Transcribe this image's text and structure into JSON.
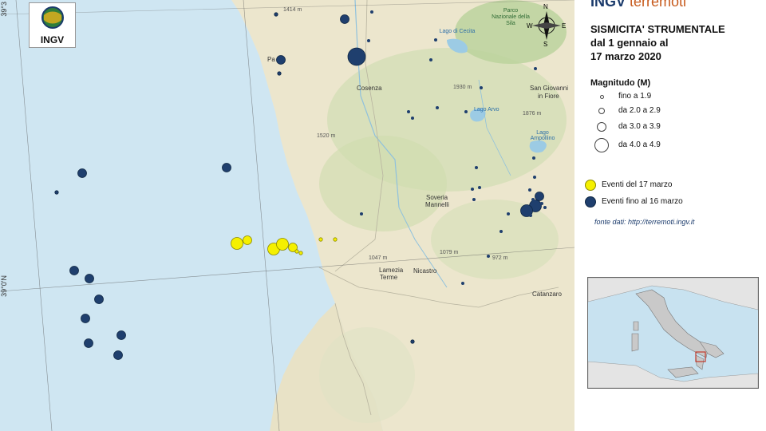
{
  "brand": {
    "part1": "INGV",
    "part2": "terremoti"
  },
  "logo": {
    "text": "INGV"
  },
  "title": {
    "line1": "SISMICITA' STRUMENTALE",
    "line2": "dal 1 gennaio al",
    "line3": "17 marzo 2020"
  },
  "magnitude_legend": {
    "title": "Magnitudo (M)",
    "classes": [
      {
        "label": "fino a 1.9",
        "size": 1
      },
      {
        "label": "da 2.0 a 2.9",
        "size": 2
      },
      {
        "label": "da 3.0 a 3.9",
        "size": 3
      },
      {
        "label": "da 4.0 a 4.9",
        "size": 4
      }
    ]
  },
  "event_legend": [
    {
      "label": "Eventi del 17 marzo",
      "color": "#f5f000"
    },
    {
      "label": "Eventi fino al 16 marzo",
      "color": "#1f3f6e"
    }
  ],
  "source": "fonte dati: http://terremoti.ingv.it",
  "lat_labels": {
    "top": "39°3",
    "middle": "39°0'N"
  },
  "compass": {
    "n": "N",
    "s": "S",
    "e": "E",
    "w": "W"
  },
  "colors": {
    "sea": "#cfe6f2",
    "land": "#ece6cd",
    "event_old": "#1f3f6e",
    "event_new": "#f5f000",
    "brand_red": "#c75a1c"
  },
  "places": [
    {
      "name": "Cosenza",
      "kind": "city"
    },
    {
      "name": "San Giovanni",
      "kind": "city"
    },
    {
      "name": "in Fiore",
      "kind": "city"
    },
    {
      "name": "Soveria",
      "kind": "city"
    },
    {
      "name": "Mannelli",
      "kind": "city"
    },
    {
      "name": "Lamezia",
      "kind": "city"
    },
    {
      "name": "Terme",
      "kind": "city"
    },
    {
      "name": "Nicastro",
      "kind": "city"
    },
    {
      "name": "Catanzaro",
      "kind": "city"
    },
    {
      "name": "Lago di Cecita",
      "kind": "lake"
    },
    {
      "name": "Lago Arvo",
      "kind": "lake"
    },
    {
      "name": "Lago Ampollino",
      "kind": "lake"
    },
    {
      "name": "Parco Nazionale della Sila",
      "kind": "park"
    },
    {
      "name": "1414 m",
      "kind": "elev"
    },
    {
      "name": "1930 m",
      "kind": "elev"
    },
    {
      "name": "1876 m",
      "kind": "elev"
    },
    {
      "name": "1520 m",
      "kind": "elev"
    },
    {
      "name": "1047 m",
      "kind": "elev"
    },
    {
      "name": "1079 m",
      "kind": "elev"
    },
    {
      "name": "972 m",
      "kind": "elev"
    },
    {
      "name": "Pa",
      "kind": "city"
    }
  ],
  "events": [
    {
      "mag": 4.3,
      "type": "old"
    },
    {
      "mag": 2.8,
      "type": "old"
    },
    {
      "mag": 2.8,
      "type": "old"
    },
    {
      "mag": 1.5,
      "type": "old"
    },
    {
      "mag": 1.5,
      "type": "old"
    },
    {
      "mag": 2.8,
      "type": "old"
    },
    {
      "mag": 2.8,
      "type": "old"
    },
    {
      "mag": 1.8,
      "type": "old"
    },
    {
      "mag": 2.8,
      "type": "old"
    },
    {
      "mag": 2.8,
      "type": "old"
    },
    {
      "mag": 2.8,
      "type": "old"
    },
    {
      "mag": 2.8,
      "type": "old"
    },
    {
      "mag": 2.8,
      "type": "old"
    },
    {
      "mag": 2.2,
      "type": "old"
    },
    {
      "mag": 2.8,
      "type": "old"
    },
    {
      "mag": 1.5,
      "type": "old"
    },
    {
      "mag": 3.0,
      "type": "old"
    },
    {
      "mag": 3.0,
      "type": "old"
    },
    {
      "mag": 2.8,
      "type": "old"
    },
    {
      "mag": 3.2,
      "type": "new"
    },
    {
      "mag": 3.3,
      "type": "new"
    },
    {
      "mag": 2.4,
      "type": "new"
    },
    {
      "mag": 3.3,
      "type": "new"
    },
    {
      "mag": 2.4,
      "type": "new"
    },
    {
      "mag": 1.5,
      "type": "new"
    },
    {
      "mag": 1.5,
      "type": "new"
    },
    {
      "mag": 1.5,
      "type": "new"
    },
    {
      "mag": 1.5,
      "type": "new"
    }
  ]
}
